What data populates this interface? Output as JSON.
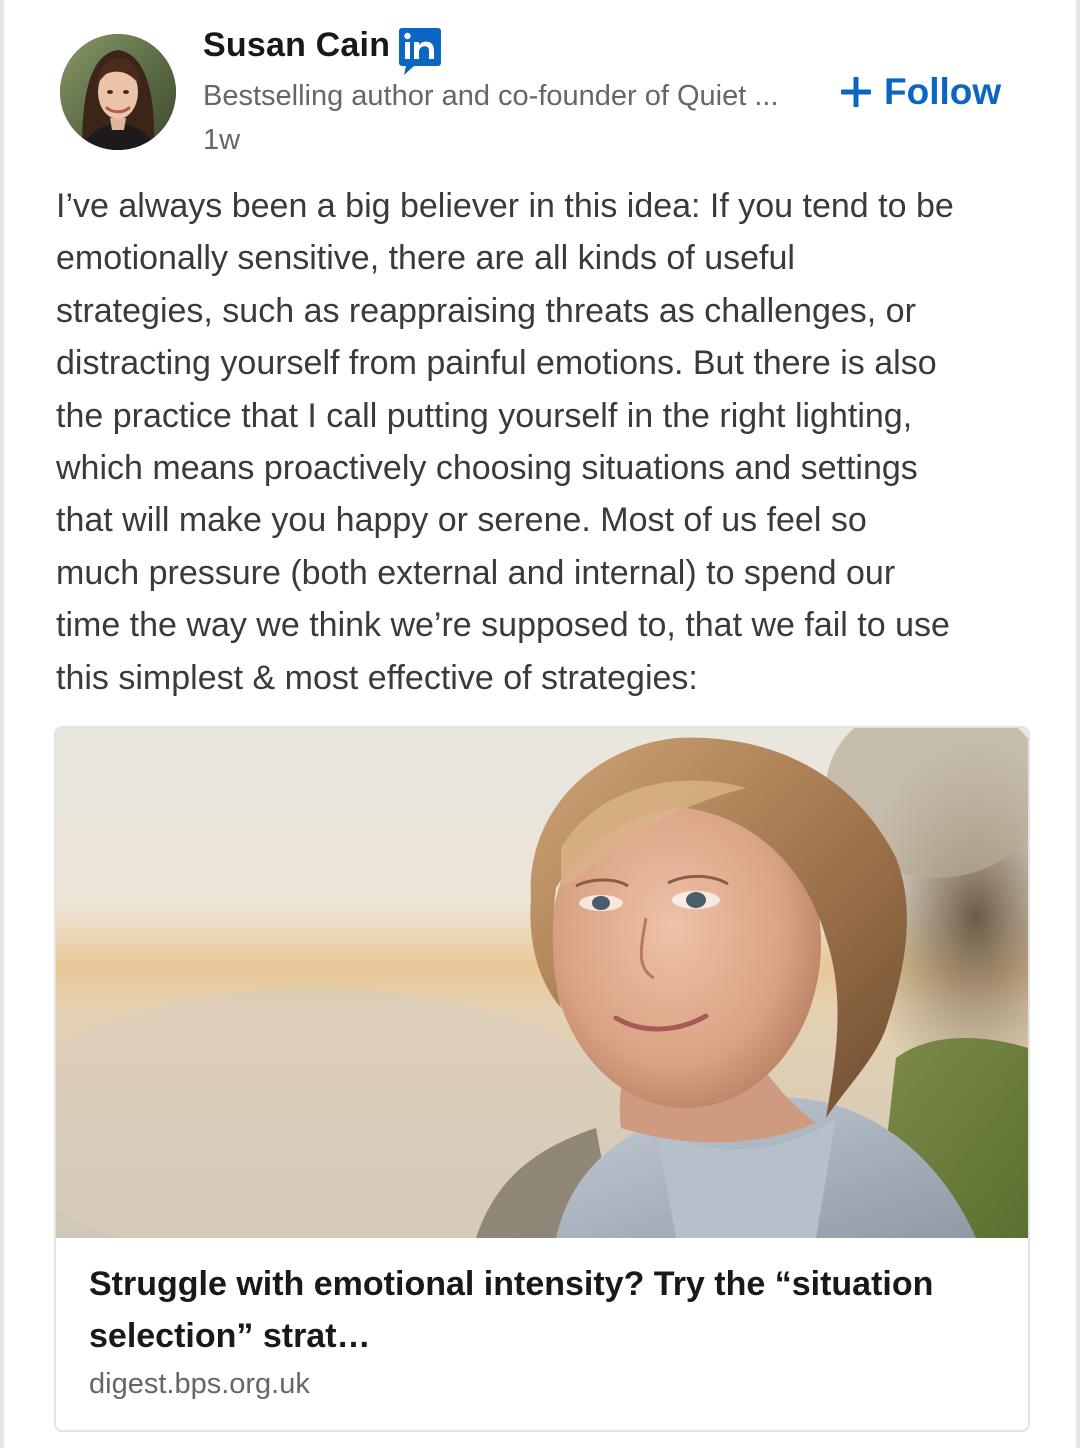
{
  "post": {
    "author": {
      "name": "Susan Cain",
      "headline": "Bestselling author and co-founder of Quiet ...",
      "time": "1w",
      "avatar_icon": "profile-photo",
      "badge_icon": "linkedin-icon",
      "badge_text": "in"
    },
    "follow": {
      "label": "Follow",
      "icon": "plus-icon",
      "color": "#0a66c2"
    },
    "text_lines": [
      "I’ve always been a big believer in this idea: If you tend to be",
      "emotionally sensitive, there are all kinds of useful",
      "strategies, such as reappraising threats as challenges, or",
      "distracting yourself from painful emotions. But there is also",
      "the practice that I call putting yourself in the right lighting,",
      "which means proactively choosing situations and settings",
      "that will make you happy or serene. Most of us feel so",
      "much pressure (both external and internal) to spend our",
      "time the way we think we’re supposed to, that we fail to use",
      "this simplest & most effective of strategies:"
    ],
    "article": {
      "image_icon": "article-photo",
      "title_line1": "Struggle with emotional intensity? Try the “situation",
      "title_line2": "selection” strat…",
      "source": "digest.bps.org.uk"
    }
  }
}
